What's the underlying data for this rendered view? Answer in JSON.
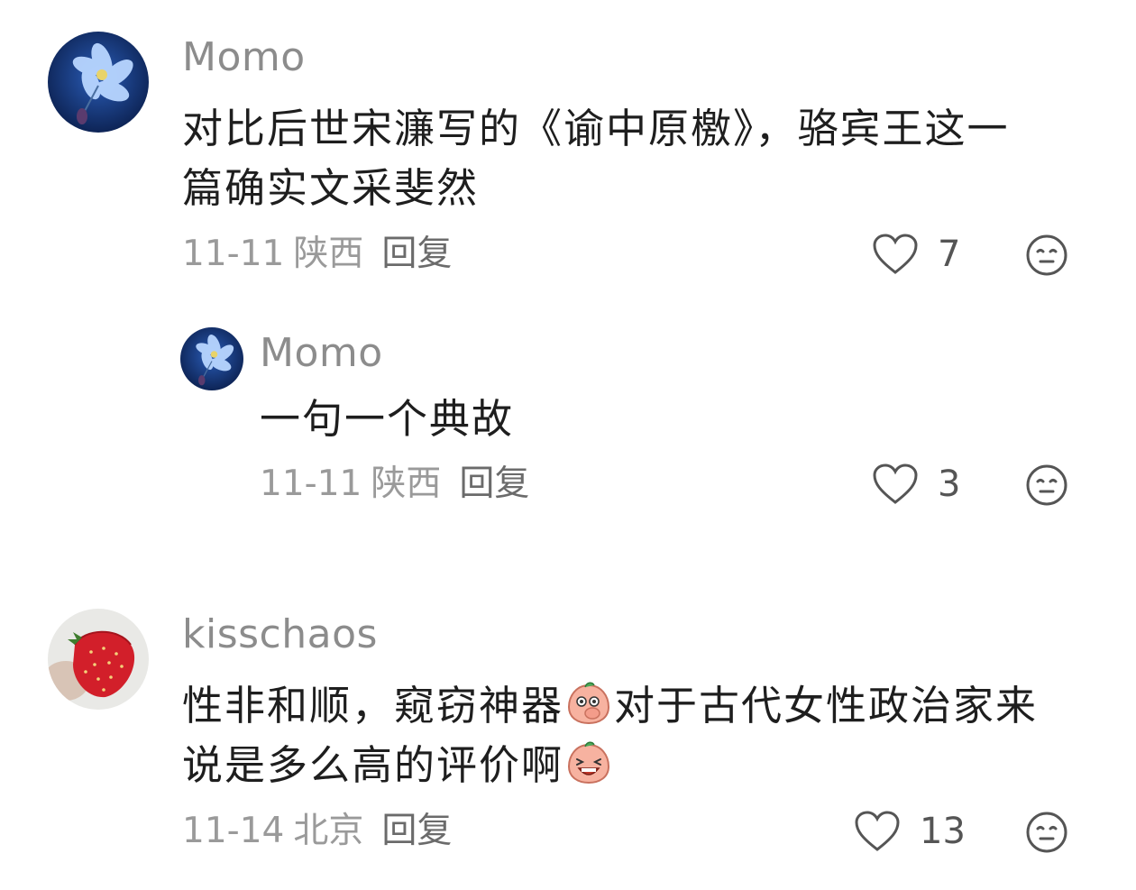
{
  "comments": [
    {
      "username": "Momo",
      "text_line1": "对比后世宋濂写的《谕中原檄》，骆宾王这一",
      "text_line2": "篇确实文采斐然",
      "date": "11-11",
      "location": "陕西",
      "reply_label": "回复",
      "likes": "7",
      "avatar": "blue-flower"
    },
    {
      "username": "Momo",
      "text_line1": "一句一个典故",
      "date": "11-11",
      "location": "陕西",
      "reply_label": "回复",
      "likes": "3",
      "avatar": "blue-flower"
    },
    {
      "username": "kisschaos",
      "text_line1_a": "性非和顺，窥窃神器",
      "text_line1_b": "对于古代女性政治家来",
      "text_line2": "说是多么高的评价啊",
      "date": "11-14",
      "location": "北京",
      "reply_label": "回复",
      "likes": "13",
      "avatar": "strawberry"
    }
  ],
  "icons": {
    "like": "heart-outline-icon",
    "dislike": "neutral-face-icon",
    "emoji_1": "peach-cover-mouth-emoji",
    "emoji_2": "peach-laughing-emoji"
  },
  "colors": {
    "username": "#8c8c8c",
    "meta": "#9a9a9a",
    "text": "#1e1e1e",
    "icon": "#555555"
  }
}
